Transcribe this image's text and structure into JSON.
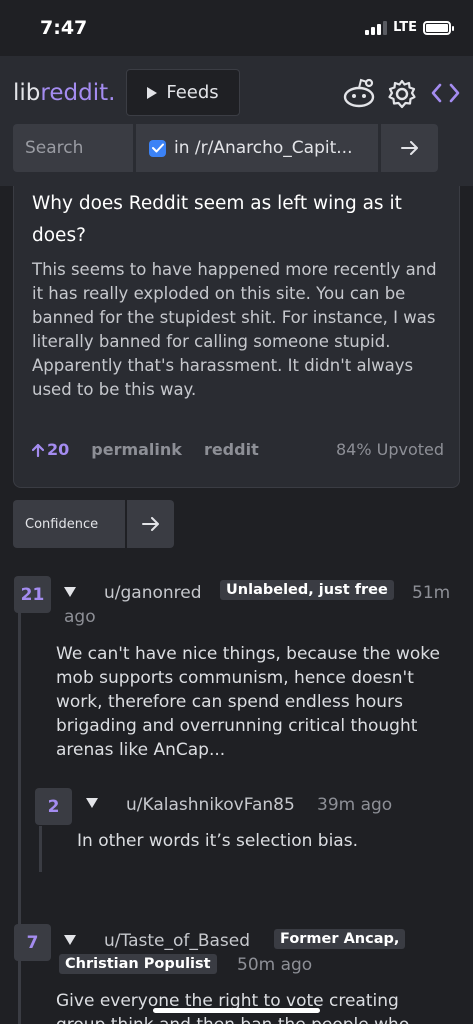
{
  "status_bar": {
    "time": "7:47",
    "network": "LTE"
  },
  "header": {
    "logo_lib": "lib",
    "logo_reddit": "reddit.",
    "feeds_label": "Feeds",
    "search_placeholder": "Search",
    "scope_label": "in /r/Anarcho_Capit...",
    "scope_checked": true
  },
  "post": {
    "title": "Why does Reddit seem as left wing as it does?",
    "body": "This seems to have happened more recently and it has really exploded on this site. You can be banned for the stupidest shit. For instance, I was literally banned for calling someone stupid. Apparently that's harassment. It didn't always used to be this way.",
    "score": "20",
    "permalink_label": "permalink",
    "reddit_label": "reddit",
    "upvoted": "84% Upvoted"
  },
  "sort": {
    "label": "Confidence"
  },
  "comments": [
    {
      "score": "21",
      "author": "u/ganonred",
      "flair": "Unlabeled, just free",
      "time_line1": "51m",
      "time_line2": "ago",
      "body": "We can't have nice things, because the woke mob supports communism, hence doesn't work, therefore can spend endless hours brigading and overrunning critical thought arenas like AnCap...",
      "replies": [
        {
          "score": "2",
          "author": "u/KalashnikovFan85",
          "time": "39m ago",
          "body": "In other words it’s selection bias."
        }
      ]
    },
    {
      "score": "7",
      "author": "u/Taste_of_Based",
      "flair_line1": "Former Ancap,",
      "flair_line2": "Christian Populist",
      "time": "50m ago",
      "body_line1": "Give everyone the right to vote creating",
      "body_line2": "group think and then ban the people who"
    }
  ],
  "colors": {
    "background": "#1f2024",
    "surface": "#2a2c32",
    "control": "#3a3c43",
    "accent": "#a48cf0",
    "checkbox": "#3b82f6",
    "muted": "#8d8f96"
  }
}
